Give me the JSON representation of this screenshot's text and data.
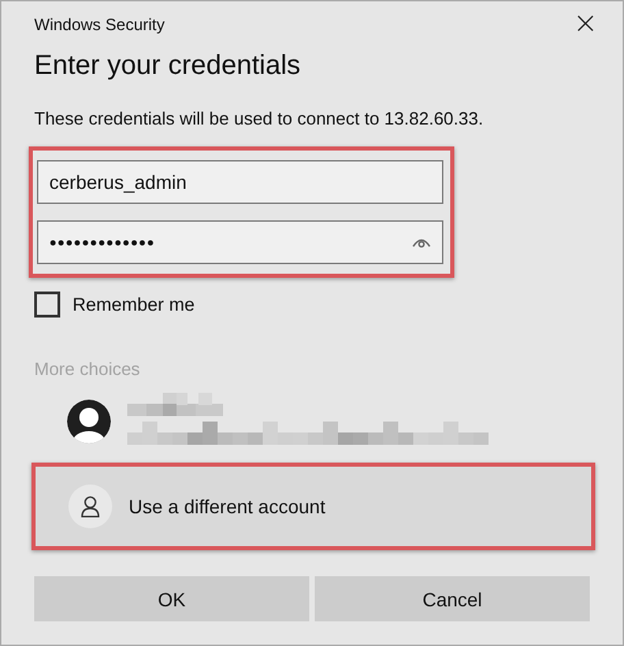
{
  "window": {
    "title": "Windows Security",
    "close": "×"
  },
  "heading": "Enter your credentials",
  "description": "These credentials will be used to connect to 13.82.60.33.",
  "credentials": {
    "highlighted": true,
    "username": {
      "value": "cerberus_admin"
    },
    "password": {
      "value": "●●●●●●●●●●●●●"
    }
  },
  "remember": {
    "label": "Remember me",
    "checked": false
  },
  "more_choices": {
    "label": "More choices",
    "disabled": true
  },
  "other_account": {
    "label": "Use a different account",
    "highlighted": true
  },
  "buttons": [
    {
      "label": "OK"
    },
    {
      "label": "Cancel"
    }
  ]
}
